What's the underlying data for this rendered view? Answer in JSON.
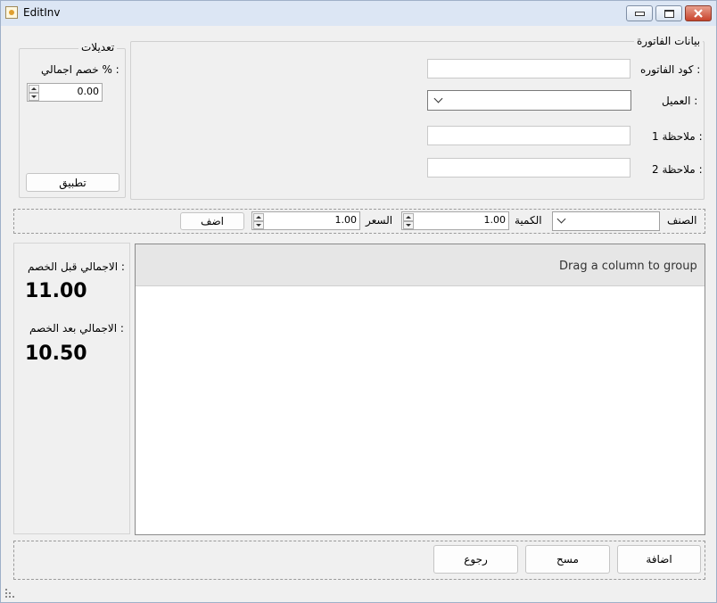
{
  "window": {
    "title": "EditInv",
    "minimize_icon": "minimize-icon",
    "maximize_icon": "maximize-icon",
    "close_icon": "close-icon"
  },
  "invoice": {
    "group_title": "بيانات الفاتورة",
    "code_label": "كود الفاتوره :",
    "code_value": "",
    "customer_label": "العميل :",
    "customer_value": "",
    "note1_label": "ملاحظة 1 :",
    "note1_value": "",
    "note2_label": "ملاحظة 2 :",
    "note2_value": ""
  },
  "adjustments": {
    "group_title": "تعديلات",
    "discount_label": "خصم اجمالي % :",
    "discount_value": "0.00",
    "apply_label": "تطبيق"
  },
  "item_bar": {
    "item_label": "الصنف",
    "item_value": "",
    "quantity_label": "الكمية",
    "quantity_value": "1.00",
    "price_label": "السعر",
    "price_value": "1.00",
    "add_label": "اضف"
  },
  "totals": {
    "before_label": "الاجمالي قبل الخصم :",
    "before_value": "11.00",
    "after_label": "الاجمالي بعد الخصم :",
    "after_value": "10.50"
  },
  "grid": {
    "group_panel_text": "Drag a column to group"
  },
  "actions": {
    "add_label": "اضافة",
    "clear_label": "مسح",
    "back_label": "رجوع"
  }
}
